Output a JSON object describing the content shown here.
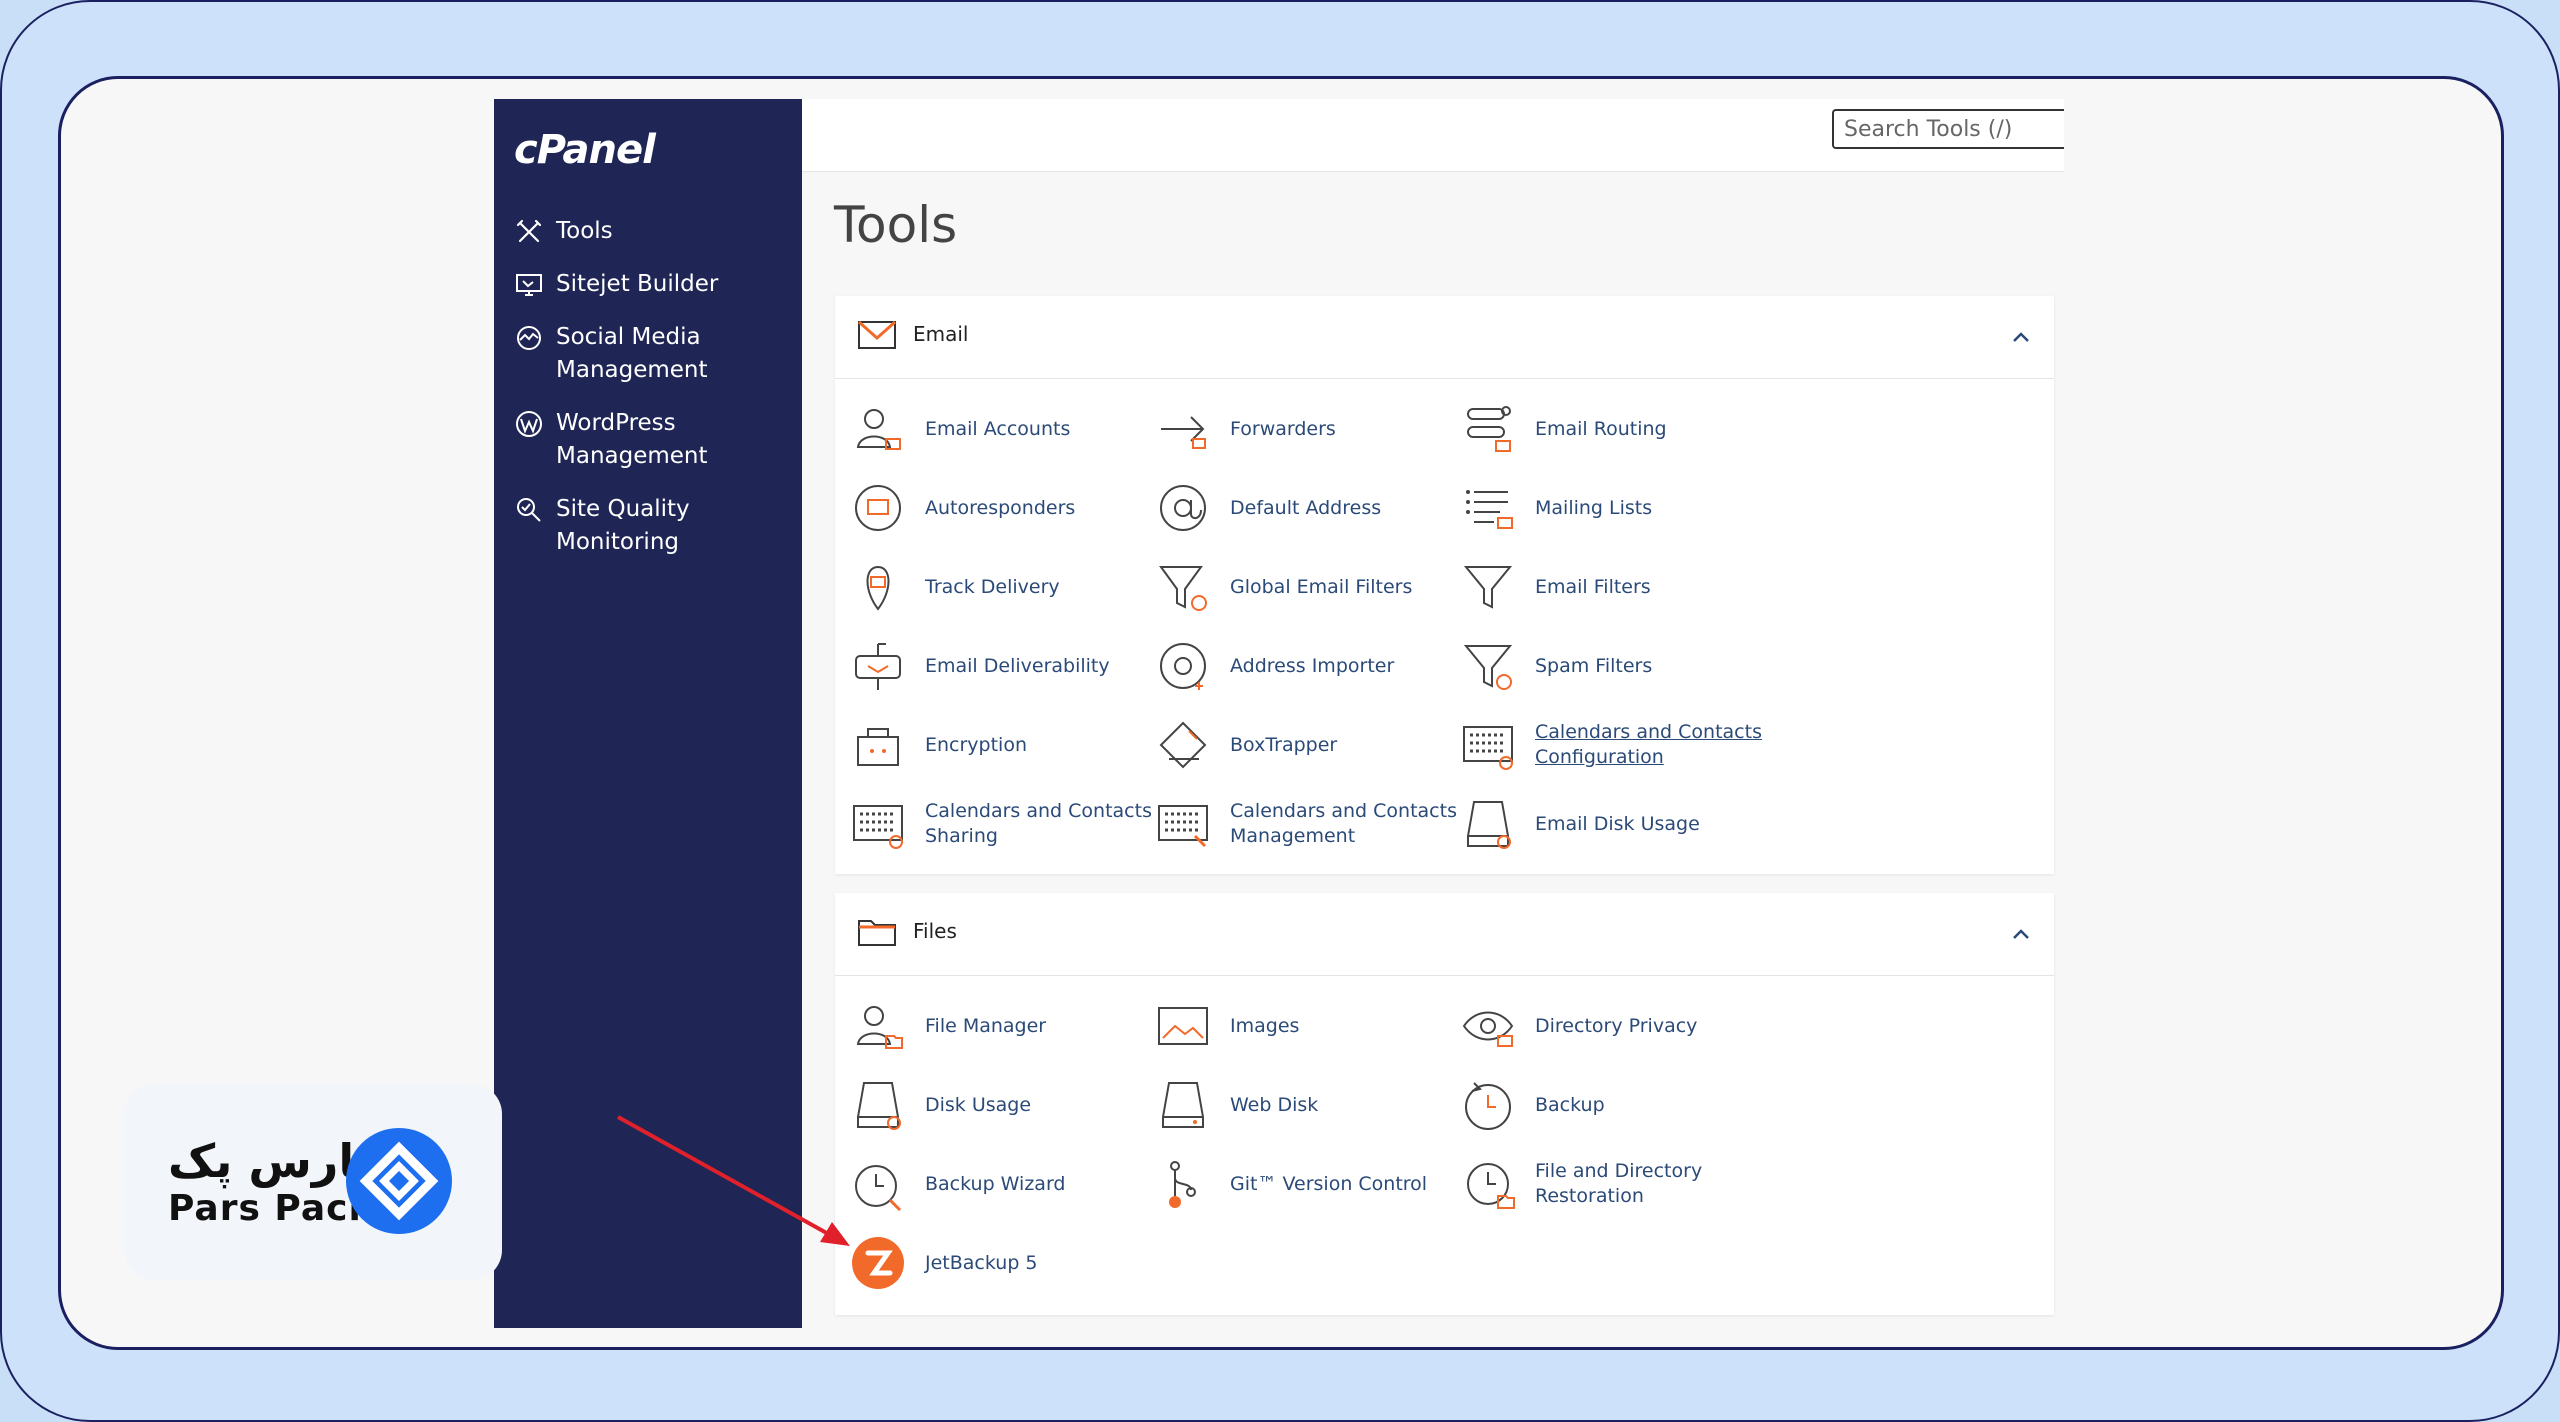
{
  "sidebar": {
    "logo": "cPanel",
    "items": [
      {
        "label": "Tools",
        "icon": "tools-icon"
      },
      {
        "label": "Sitejet Builder",
        "icon": "sitejet-icon"
      },
      {
        "label": "Social Media\nManagement",
        "icon": "social-media-icon"
      },
      {
        "label": "WordPress\nManagement",
        "icon": "wordpress-icon"
      },
      {
        "label": "Site Quality\nMonitoring",
        "icon": "site-quality-icon"
      }
    ]
  },
  "search": {
    "placeholder": "Search Tools (/)"
  },
  "page": {
    "title": "Tools"
  },
  "email": {
    "title": "Email",
    "tools": [
      {
        "label": "Email Accounts",
        "icon": "email-accounts-icon"
      },
      {
        "label": "Forwarders",
        "icon": "forwarders-icon"
      },
      {
        "label": "Email Routing",
        "icon": "email-routing-icon"
      },
      {
        "label": "Autoresponders",
        "icon": "autoresponders-icon"
      },
      {
        "label": "Default Address",
        "icon": "default-address-icon"
      },
      {
        "label": "Mailing Lists",
        "icon": "mailing-lists-icon"
      },
      {
        "label": "Track Delivery",
        "icon": "track-delivery-icon"
      },
      {
        "label": "Global Email Filters",
        "icon": "global-email-filters-icon"
      },
      {
        "label": "Email Filters",
        "icon": "email-filters-icon"
      },
      {
        "label": "Email Deliverability",
        "icon": "email-deliverability-icon"
      },
      {
        "label": "Address Importer",
        "icon": "address-importer-icon"
      },
      {
        "label": "Spam Filters",
        "icon": "spam-filters-icon"
      },
      {
        "label": "Encryption",
        "icon": "encryption-icon"
      },
      {
        "label": "BoxTrapper",
        "icon": "boxtrapper-icon"
      },
      {
        "label": "Calendars and Contacts Configuration",
        "icon": "calendars-configuration-icon"
      },
      {
        "label": "Calendars and Contacts Sharing",
        "icon": "calendars-sharing-icon"
      },
      {
        "label": "Calendars and Contacts Management",
        "icon": "calendars-management-icon"
      },
      {
        "label": "Email Disk Usage",
        "icon": "email-disk-usage-icon"
      }
    ]
  },
  "files": {
    "title": "Files",
    "tools": [
      {
        "label": "File Manager",
        "icon": "file-manager-icon"
      },
      {
        "label": "Images",
        "icon": "images-icon"
      },
      {
        "label": "Directory Privacy",
        "icon": "directory-privacy-icon"
      },
      {
        "label": "Disk Usage",
        "icon": "disk-usage-icon"
      },
      {
        "label": "Web Disk",
        "icon": "web-disk-icon"
      },
      {
        "label": "Backup",
        "icon": "backup-icon"
      },
      {
        "label": "Backup Wizard",
        "icon": "backup-wizard-icon"
      },
      {
        "label": "Git™ Version Control",
        "icon": "git-icon"
      },
      {
        "label": "File and Directory Restoration",
        "icon": "restoration-icon"
      },
      {
        "label": "JetBackup 5",
        "icon": "jetbackup-icon"
      }
    ]
  },
  "brand": {
    "name_fa": "پارس پک",
    "name_en": "Pars Pack"
  },
  "colors": {
    "sidebar": "#1f2655",
    "accent_orange": "#f26a2a",
    "link": "#2b4a78",
    "arrow": "#e0202a",
    "brand_blue": "#1e6ff0"
  }
}
